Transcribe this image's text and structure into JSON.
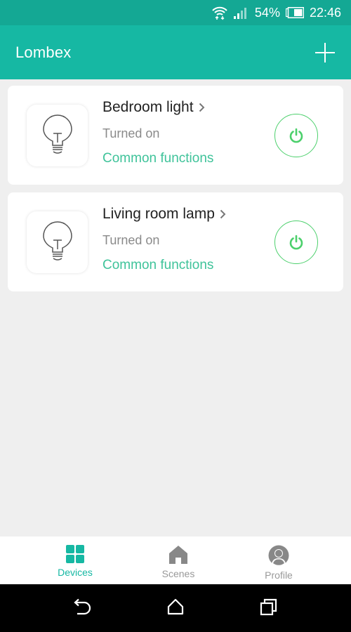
{
  "status_bar": {
    "wifi_icon": "wifi-icon",
    "signal_icon": "signal-icon",
    "battery_percent": "54%",
    "battery_icon": "battery-icon",
    "time": "22:46"
  },
  "app_bar": {
    "title": "Lombex",
    "add_icon": "plus-icon"
  },
  "devices": [
    {
      "name": "Bedroom light",
      "status": "Turned on",
      "functions_link": "Common functions",
      "icon": "lightbulb-icon",
      "power_on": true
    },
    {
      "name": "Living room lamp",
      "status": "Turned on",
      "functions_link": "Common functions",
      "icon": "lightbulb-icon",
      "power_on": true
    }
  ],
  "bottom_nav": {
    "items": [
      {
        "label": "Devices",
        "icon": "grid-icon",
        "active": true
      },
      {
        "label": "Scenes",
        "icon": "home-icon",
        "active": false
      },
      {
        "label": "Profile",
        "icon": "user-icon",
        "active": false
      }
    ]
  },
  "system_nav": [
    "back-icon",
    "home-icon",
    "recents-icon"
  ],
  "colors": {
    "primary": "#16b8a3",
    "status_bar": "#14a894",
    "accent_text": "#3fc39a",
    "power_green": "#4cd06c",
    "background": "#efefef"
  }
}
